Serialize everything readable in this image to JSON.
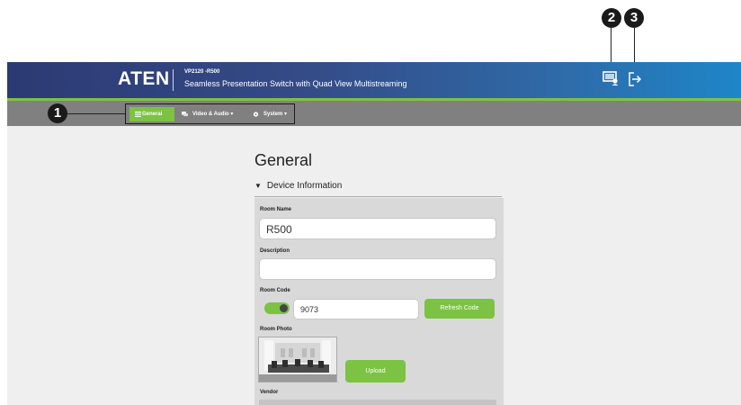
{
  "callouts": {
    "one": "1",
    "two": "2",
    "three": "3"
  },
  "header": {
    "logo": "ATEN",
    "model": "VP2120 -R500",
    "product": "Seamless Presentation Switch with Quad View Multistreaming",
    "icons": {
      "monitor": "monitor-user-icon",
      "logout": "logout-icon"
    }
  },
  "menu": {
    "items": [
      {
        "label": "General",
        "icon": "list-icon",
        "active": true
      },
      {
        "label": "Video & Audio ▾",
        "icon": "chat-icon"
      },
      {
        "label": "System ▾",
        "icon": "gear-icon"
      }
    ]
  },
  "page": {
    "title": "General",
    "section": "Device Information"
  },
  "form": {
    "room_name_label": "Room Name",
    "room_name_value": "R500",
    "description_label": "Description",
    "description_value": "",
    "room_code_label": "Room Code",
    "room_code_value": "9073",
    "room_code_enabled": true,
    "refresh_label": "Refresh Code",
    "room_photo_label": "Room Photo",
    "upload_label": "Upload",
    "vendor_label": "Vendor"
  },
  "colors": {
    "accent": "#7cc243",
    "header_start": "#2c3a73",
    "header_end": "#1e86c8",
    "menubar": "#808080"
  }
}
